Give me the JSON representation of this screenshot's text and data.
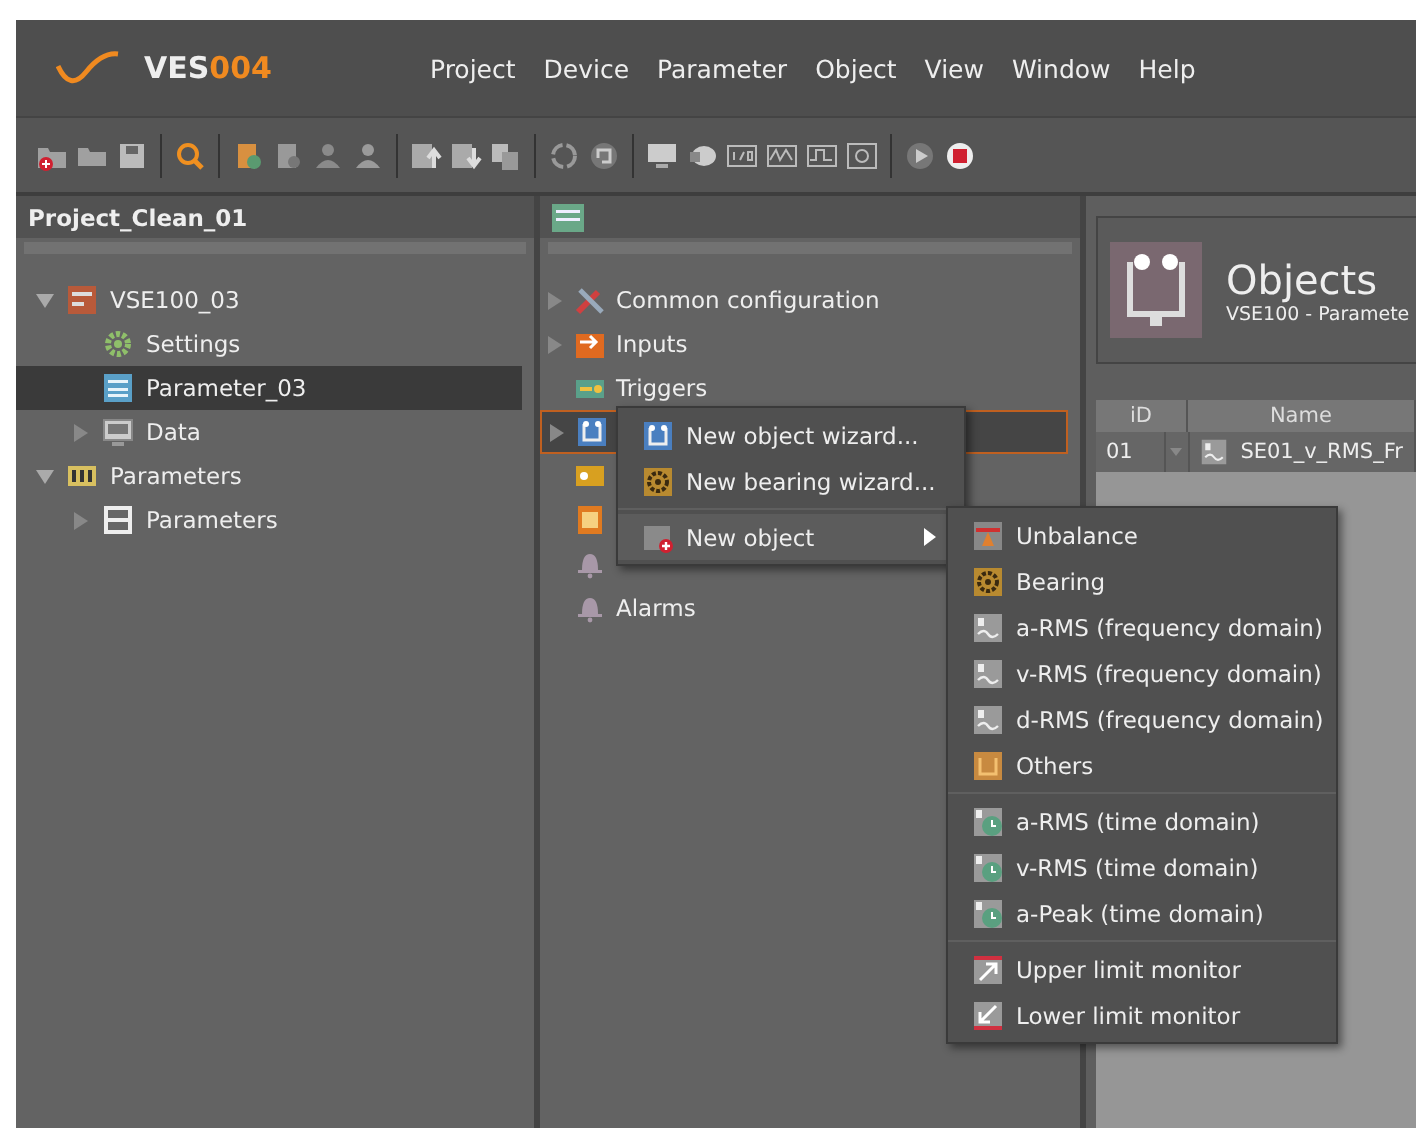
{
  "app": {
    "logo_name": "VES",
    "logo_number": "004"
  },
  "menu": [
    "Project",
    "Device",
    "Parameter",
    "Object",
    "View",
    "Window",
    "Help"
  ],
  "project_panel": {
    "title": "Project_Clean_01",
    "tree": [
      {
        "label": "VSE100_03",
        "kind": "device",
        "expanded": true,
        "selected": false,
        "children": [
          {
            "label": "Settings",
            "kind": "settings",
            "selected": false
          },
          {
            "label": "Parameter_03",
            "kind": "parameter",
            "selected": true
          },
          {
            "label": "Data",
            "kind": "data",
            "expanded": false,
            "selected": false
          }
        ]
      },
      {
        "label": "Parameters",
        "kind": "group",
        "expanded": true,
        "selected": false,
        "children": [
          {
            "label": "Parameters",
            "kind": "parameters",
            "expanded": false,
            "selected": false
          }
        ]
      }
    ]
  },
  "config_panel": {
    "tree": [
      {
        "label": "Common configuration",
        "kind": "tools",
        "expanded": false,
        "selected": false
      },
      {
        "label": "Inputs",
        "kind": "inputs",
        "expanded": false,
        "selected": false
      },
      {
        "label": "Triggers",
        "kind": "triggers",
        "selected": false
      },
      {
        "kind": "objects",
        "expanded": false,
        "selected": true
      },
      {
        "kind": "status",
        "selected": false
      },
      {
        "kind": "io",
        "selected": false
      },
      {
        "kind": "bell",
        "selected": false
      },
      {
        "label": "Alarms",
        "kind": "bell",
        "selected": false
      }
    ]
  },
  "context_menu": {
    "items": [
      {
        "label": "New object wizard...",
        "kind": "objects",
        "selected": false
      },
      {
        "label": "New bearing wizard...",
        "kind": "bearing",
        "selected": false
      },
      {
        "label": "New object",
        "kind": "new",
        "submenu": true,
        "selected": true
      }
    ]
  },
  "submenu": {
    "groups": [
      [
        {
          "label": "Unbalance",
          "kind": "unbalance"
        },
        {
          "label": "Bearing",
          "kind": "bearing"
        },
        {
          "label": "a-RMS (frequency domain)",
          "kind": "freq"
        },
        {
          "label": "v-RMS (frequency domain)",
          "kind": "freq"
        },
        {
          "label": "d-RMS (frequency domain)",
          "kind": "freq"
        },
        {
          "label": "Others",
          "kind": "others"
        }
      ],
      [
        {
          "label": "a-RMS (time domain)",
          "kind": "time"
        },
        {
          "label": "v-RMS (time domain)",
          "kind": "time"
        },
        {
          "label": "a-Peak (time domain)",
          "kind": "time"
        }
      ],
      [
        {
          "label": "Upper limit monitor",
          "kind": "upper"
        },
        {
          "label": "Lower limit monitor",
          "kind": "lower"
        }
      ]
    ]
  },
  "objects_panel": {
    "title": "Objects",
    "subtitle": "VSE100 - Paramete",
    "columns": [
      "iD",
      "Name"
    ],
    "rows": [
      {
        "cells": [
          "01",
          "SE01_v_RMS_Fr"
        ]
      }
    ]
  }
}
